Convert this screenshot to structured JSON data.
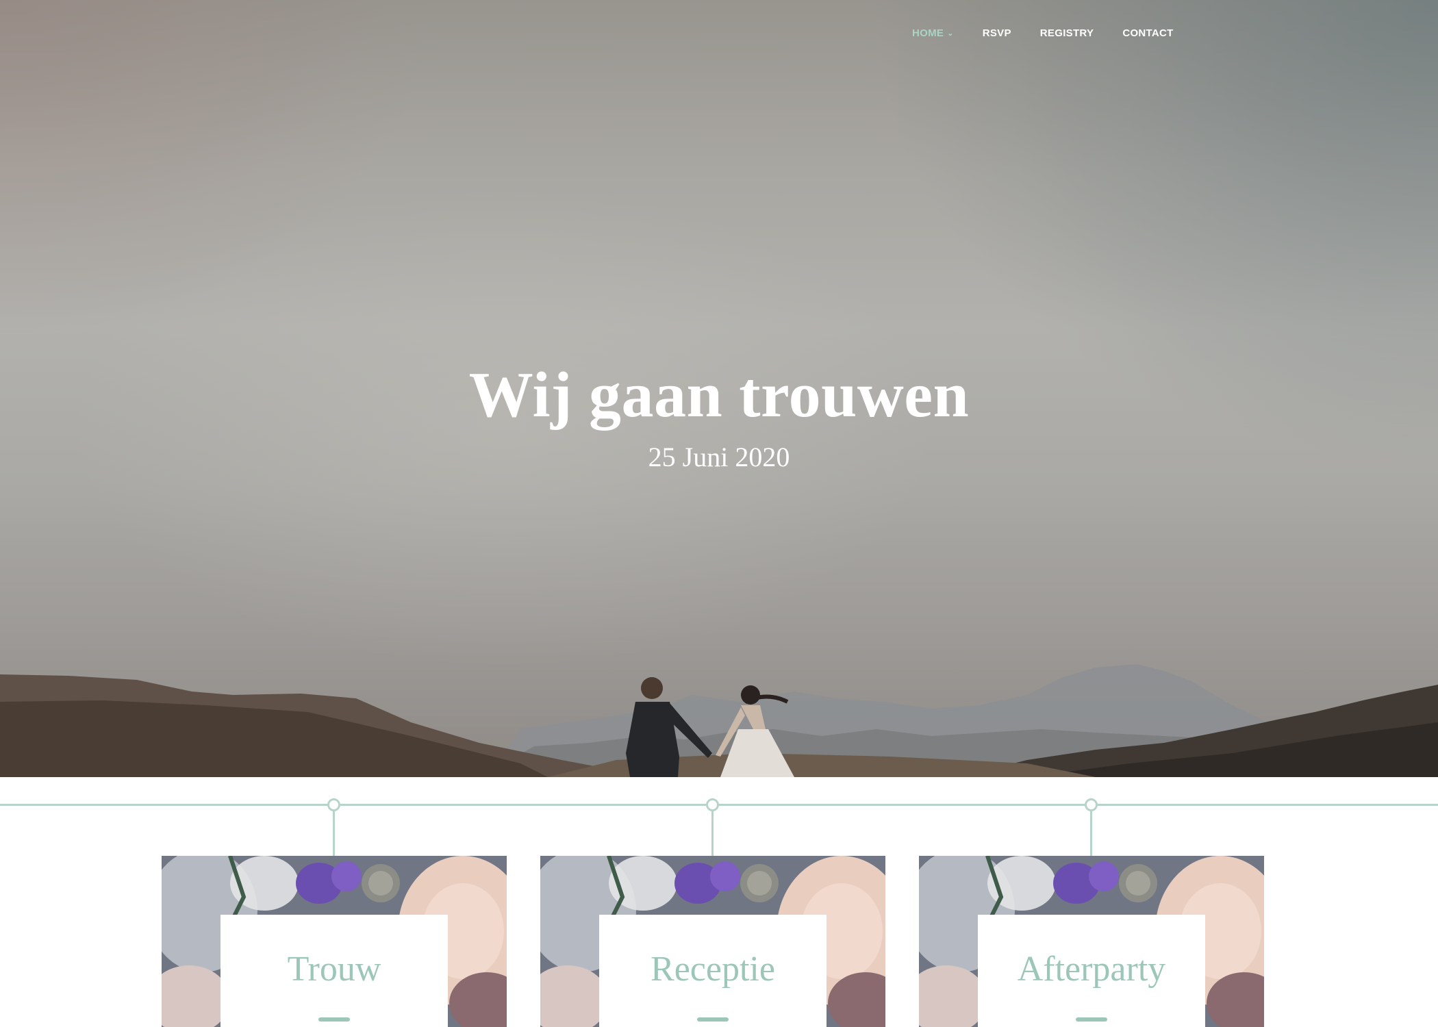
{
  "nav": {
    "items": [
      {
        "label": "HOME",
        "active": true,
        "has_dropdown": true
      },
      {
        "label": "RSVP",
        "active": false
      },
      {
        "label": "REGISTRY",
        "active": false
      },
      {
        "label": "CONTACT",
        "active": false
      }
    ]
  },
  "hero": {
    "title": "Wij gaan trouwen",
    "date": "25 Juni 2020"
  },
  "events": [
    {
      "title": "Trouw"
    },
    {
      "title": "Receptie"
    },
    {
      "title": "Afterparty"
    }
  ],
  "colors": {
    "accent": "#9cc7b8",
    "timeline": "#b7d3ca",
    "nav_active": "#a9d4c6",
    "text_light": "#ffffff"
  },
  "icons": {
    "dropdown": "chevron-down-icon"
  }
}
